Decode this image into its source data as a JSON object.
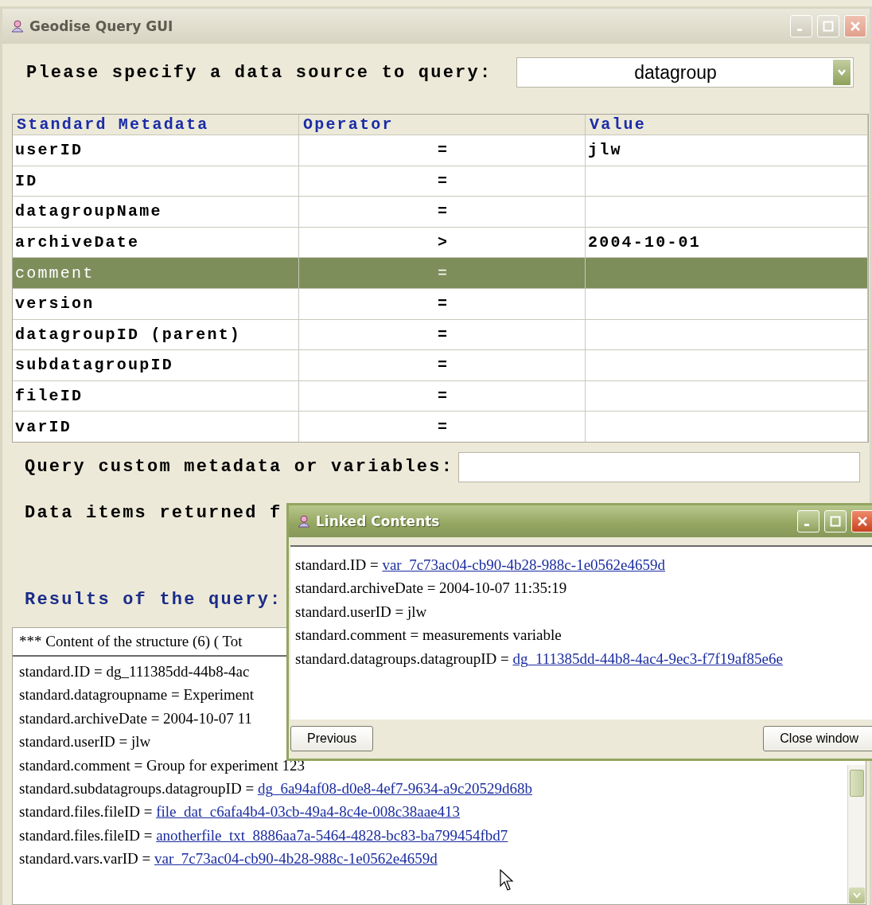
{
  "main_window": {
    "title": "Geodise Query GUI"
  },
  "source": {
    "label": "Please specify a data source to query:",
    "value": "datagroup"
  },
  "table": {
    "columns": [
      "Standard Metadata",
      "Operator",
      "Value"
    ],
    "rows": [
      {
        "field": "userID",
        "operator": "=",
        "value": "jlw",
        "selected": false
      },
      {
        "field": "ID",
        "operator": "=",
        "selected": false
      },
      {
        "field": "datagroupName",
        "operator": "=",
        "selected": false
      },
      {
        "field": "archiveDate",
        "operator": ">",
        "value": "2004-10-01",
        "selected": false
      },
      {
        "field": "comment",
        "operator": "=",
        "selected": true
      },
      {
        "field": "version",
        "operator": "=",
        "selected": false
      },
      {
        "field": "datagroupID (parent)",
        "operator": "=",
        "selected": false
      },
      {
        "field": "subdatagroupID",
        "operator": "=",
        "selected": false
      },
      {
        "field": "fileID",
        "operator": "=",
        "selected": false
      },
      {
        "field": "varID",
        "operator": "=",
        "selected": false
      }
    ]
  },
  "custom_query": {
    "label": "Query custom metadata or variables:"
  },
  "data_items": {
    "label": "Data items returned f"
  },
  "results": {
    "label": "Results of the query:",
    "header": "*** Content of the structure (6) ( Tot",
    "lines": [
      {
        "text": "standard.ID = dg_111385dd-44b8-4ac"
      },
      {
        "text": "standard.datagroupname = Experiment"
      },
      {
        "text": "standard.archiveDate = 2004-10-07 11"
      },
      {
        "text": "standard.userID = jlw"
      },
      {
        "text": "standard.comment = Group for experiment 123"
      },
      {
        "text": "standard.subdatagroups.datagroupID =",
        "link": "dg_6a94af08-d0e8-4ef7-9634-a9c20529d68b"
      },
      {
        "text": "standard.files.fileID =",
        "link": "file_dat_c6afa4b4-03cb-49a4-8c4e-008c38aae413"
      },
      {
        "text": "standard.files.fileID =",
        "link": "anotherfile_txt_8886aa7a-5464-4828-bc83-ba799454fbd7"
      },
      {
        "text": "standard.vars.varID =",
        "link": "var_7c73ac04-cb90-4b28-988c-1e0562e4659d"
      }
    ]
  },
  "linked_window": {
    "title": "Linked Contents",
    "lines": [
      {
        "text": "standard.ID =",
        "link": "var_7c73ac04-cb90-4b28-988c-1e0562e4659d"
      },
      {
        "text": "standard.archiveDate = 2004-10-07 11:35:19"
      },
      {
        "text": "standard.userID = jlw"
      },
      {
        "text": "standard.comment = measurements variable"
      },
      {
        "text": "standard.datagroups.datagroupID =",
        "link": "dg_111385dd-44b8-4ac4-9ec3-f7f19af85e6e"
      }
    ],
    "buttons": [
      "Previous",
      "Close window"
    ]
  }
}
